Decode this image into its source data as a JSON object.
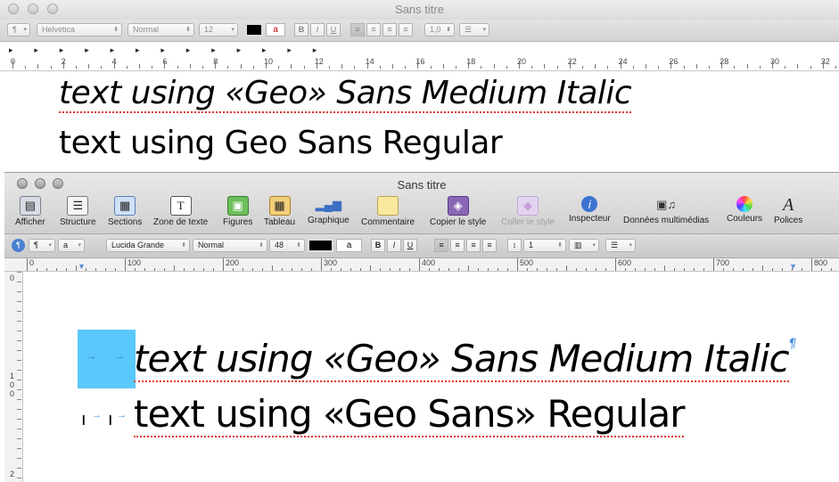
{
  "back_window": {
    "title": "Sans titre",
    "format_bar": {
      "paragraph_style": "¶",
      "font_family": "Helvetica",
      "typeface": "Normal",
      "font_size": "12",
      "bold": "B",
      "italic": "I",
      "underline": "U",
      "line_spacing": "1,0",
      "list_label": "☰"
    },
    "ruler_numbers": [
      "0",
      "2",
      "4",
      "6",
      "8",
      "10",
      "12",
      "14",
      "16",
      "18",
      "20",
      "22",
      "24",
      "26",
      "28",
      "30",
      "32"
    ],
    "document_lines": [
      "text using «Geo» Sans Medium Italic",
      "text using Geo Sans Regular"
    ]
  },
  "front_window": {
    "title": "Sans titre",
    "toolbar": [
      {
        "label": "Afficher",
        "icon": "view-icon"
      },
      {
        "label": "Structure",
        "icon": "outline-icon"
      },
      {
        "label": "Sections",
        "icon": "sections-icon"
      },
      {
        "label": "Zone de texte",
        "icon": "textbox-icon"
      },
      {
        "label": "Figures",
        "icon": "shapes-icon"
      },
      {
        "label": "Tableau",
        "icon": "table-icon"
      },
      {
        "label": "Graphique",
        "icon": "chart-icon"
      },
      {
        "label": "Commentaire",
        "icon": "comment-icon"
      },
      {
        "label": "Copier le style",
        "icon": "copy-style-icon"
      },
      {
        "label": "Coller le style",
        "icon": "paste-style-icon"
      },
      {
        "label": "Inspecteur",
        "icon": "inspector-icon"
      },
      {
        "label": "Données multimédias",
        "icon": "media-icon"
      },
      {
        "label": "Couleurs",
        "icon": "colors-icon"
      },
      {
        "label": "Polices",
        "icon": "fonts-icon"
      }
    ],
    "format_bar": {
      "paragraph_style": "¶",
      "char_style": "a",
      "font_family": "Lucida Grande",
      "typeface": "Normal",
      "font_size": "48",
      "bold": "B",
      "italic": "I",
      "underline": "U",
      "line_spacing": "1",
      "list_label": "☰"
    },
    "ruler_numbers": [
      "0",
      "100",
      "200",
      "300",
      "400",
      "500",
      "600",
      "700",
      "800"
    ],
    "vruler_numbers": [
      "0",
      "1",
      "0",
      "0",
      "2"
    ],
    "document_lines": [
      "text using «Geo» Sans Medium Italic",
      "text using «Geo Sans» Regular"
    ],
    "pilcrow": "¶"
  },
  "colors": {
    "selection": "#5ac8fa",
    "spell_underline": "#e0302e",
    "invisible_chars": "#4a90e2"
  }
}
